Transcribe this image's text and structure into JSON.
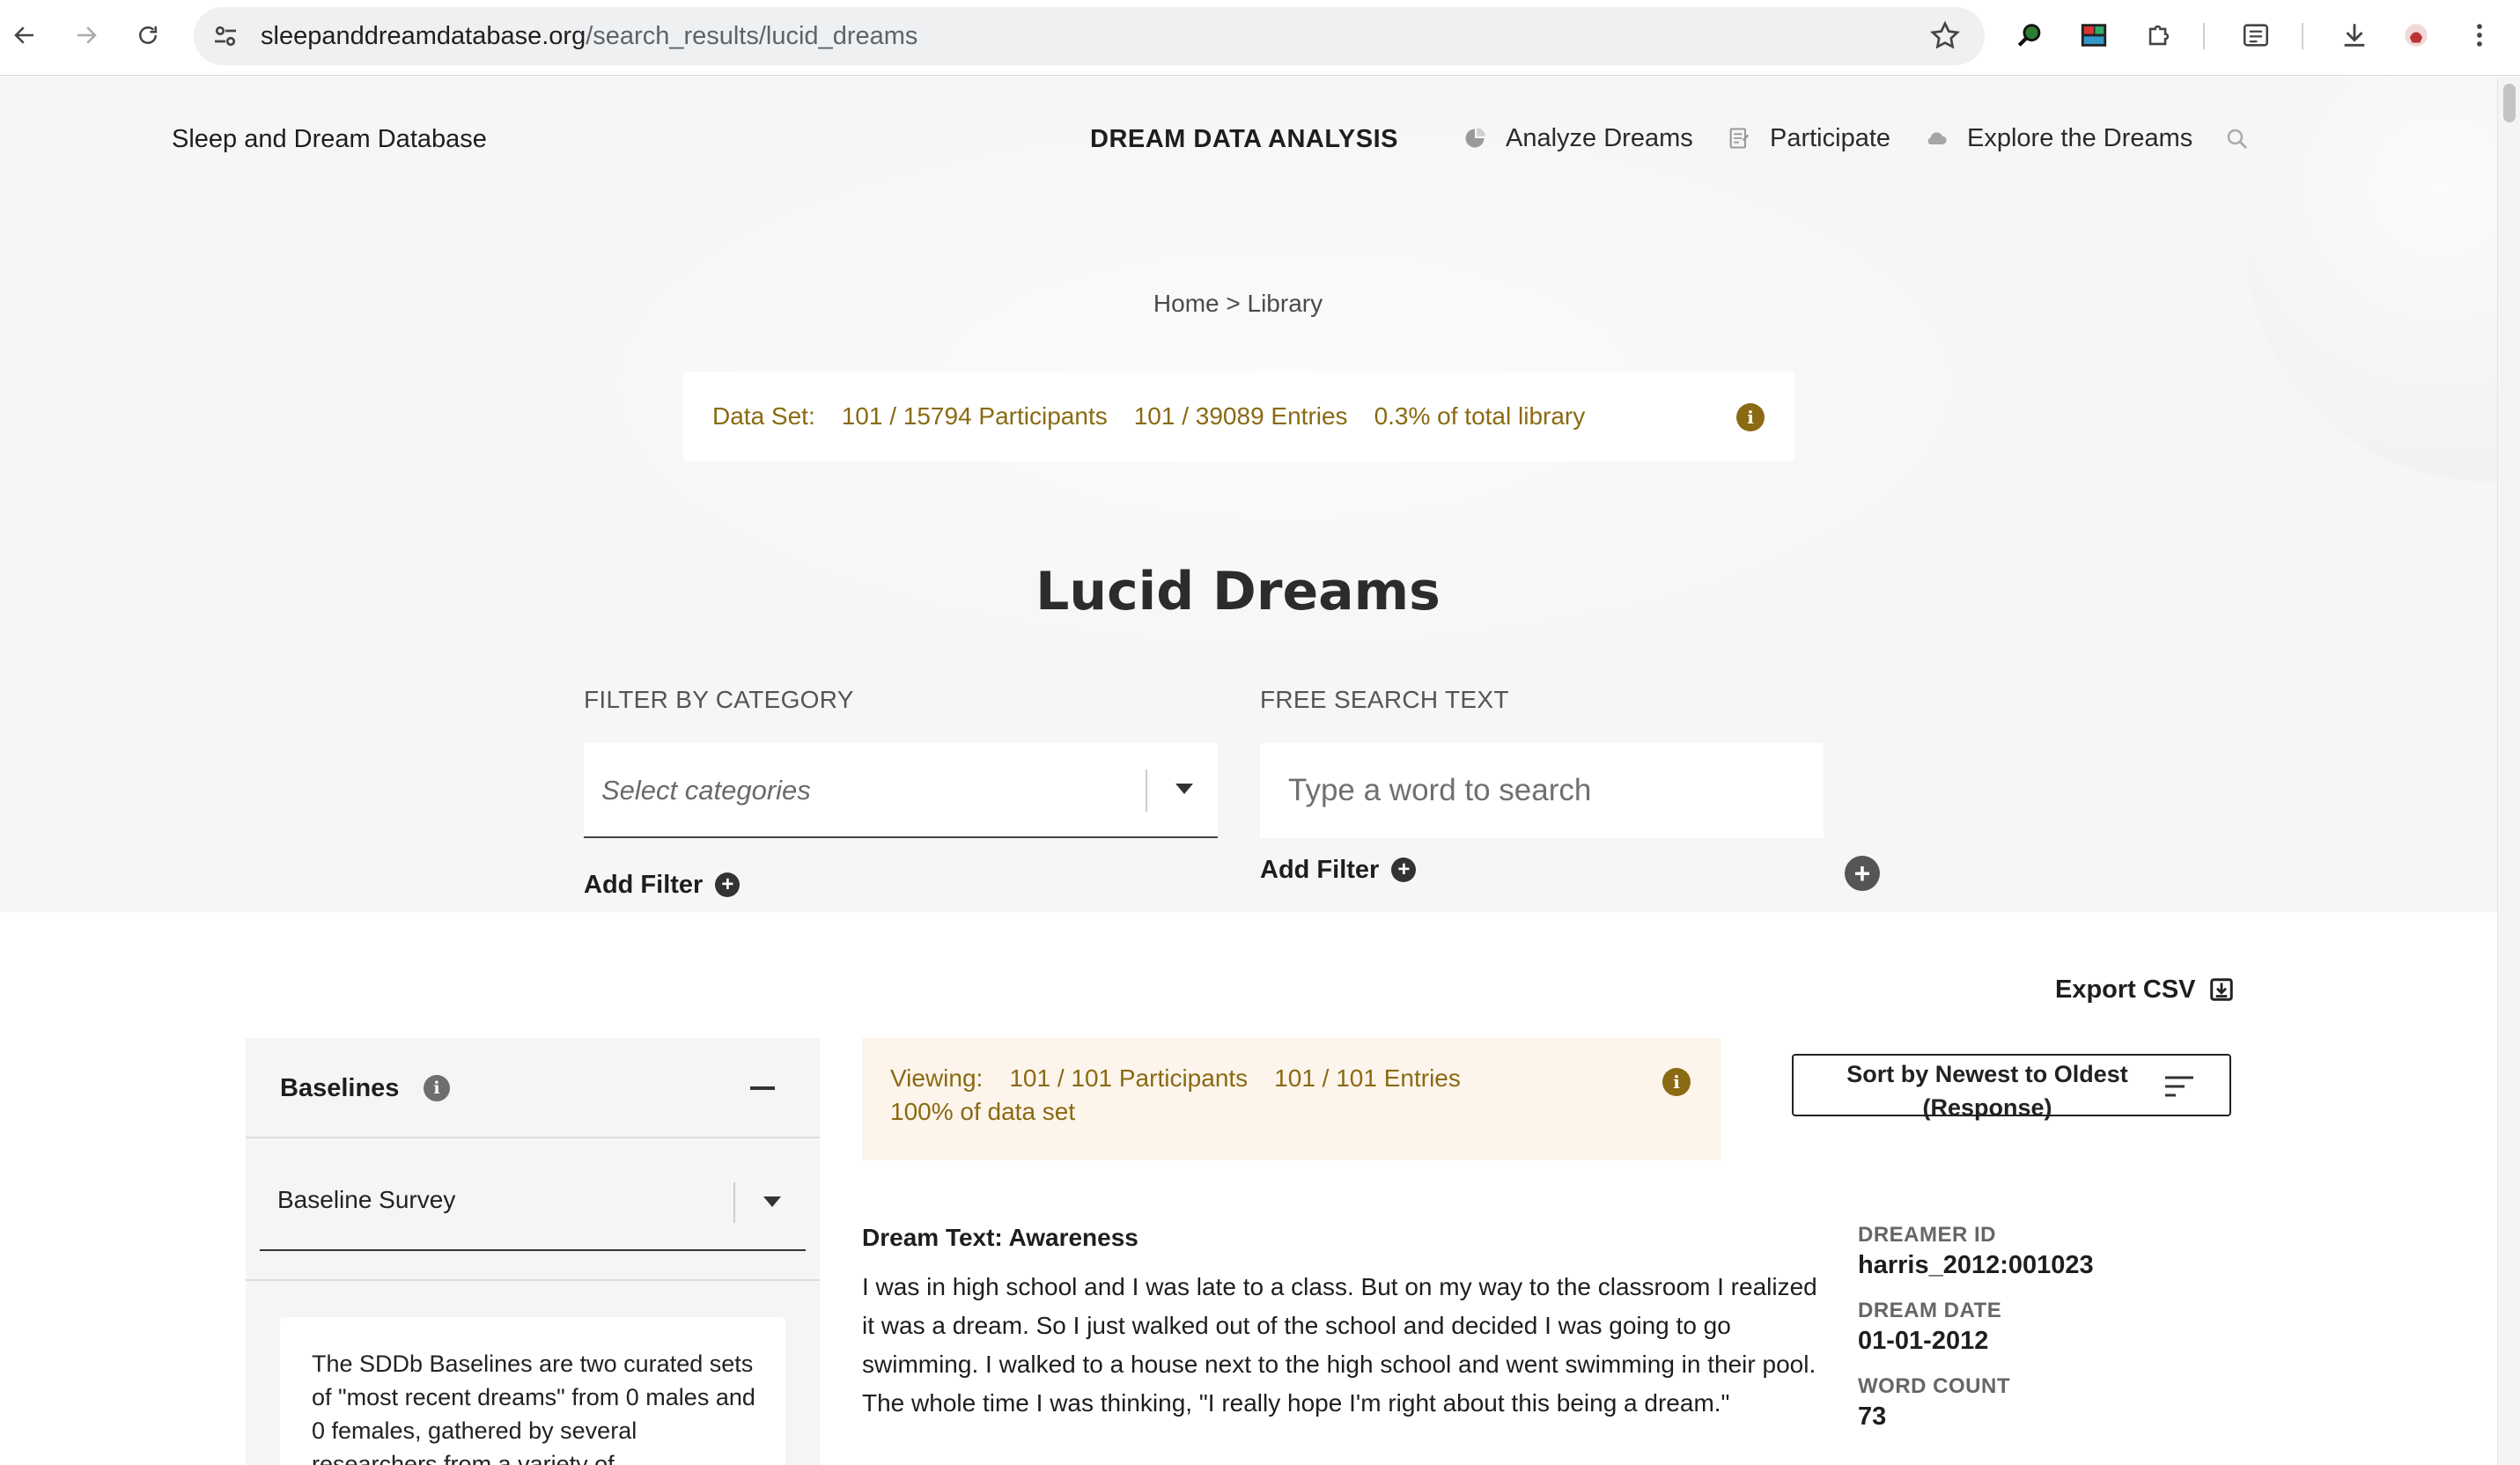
{
  "browser": {
    "url_domain": "sleepanddreamdatabase.org",
    "url_path": "/search_results/lucid_dreams"
  },
  "header": {
    "site_title": "Sleep and Dream Database",
    "section_title": "DREAM DATA ANALYSIS",
    "nav": [
      {
        "label": "Analyze Dreams",
        "icon": "pie-chart-icon"
      },
      {
        "label": "Participate",
        "icon": "form-icon"
      },
      {
        "label": "Explore the Dreams",
        "icon": "cloud-icon"
      }
    ]
  },
  "breadcrumb": "Home > Library",
  "dataset": {
    "label": "Data Set:",
    "participants": "101 / 15794 Participants",
    "entries": "101 / 39089 Entries",
    "percent": "0.3% of total library"
  },
  "page_heading": "Lucid Dreams",
  "filters": {
    "category_label": "FILTER BY CATEGORY",
    "category_placeholder": "Select categories",
    "search_label": "FREE SEARCH TEXT",
    "search_placeholder": "Type a word to search",
    "add_filter_label": "Add Filter"
  },
  "results": {
    "export_label": "Export CSV",
    "viewing_label": "Viewing:",
    "viewing_participants": "101 / 101 Participants",
    "viewing_entries": "101 / 101 Entries",
    "viewing_percent": "100% of data set",
    "sort_label": "Sort by Newest to Oldest (Response)"
  },
  "sidebar": {
    "title": "Baselines",
    "select_value": "Baseline Survey",
    "description": "The SDDb Baselines are two curated sets of \"most recent dreams\" from 0 males and 0 females, gathered by several researchers from a variety of"
  },
  "dream": {
    "title": "Dream Text: Awareness",
    "text": "I was in high school and I was late to a class. But on my way to the classroom I realized it was a dream. So I just walked out of the school and decided I was going to go swimming. I walked to a house next to the high school and went swimming in their pool. The whole time I was thinking, \"I really hope I'm right about this being a dream.\"",
    "dreamer_id_label": "DREAMER ID",
    "dreamer_id": "harris_2012:001023",
    "date_label": "DREAM DATE",
    "date": "01-01-2012",
    "word_count_label": "WORD COUNT",
    "word_count": "73"
  },
  "colors": {
    "gold_text": "#8a6a12",
    "viewing_bg": "#fdf5ec",
    "page_gray": "#f6f6f6"
  }
}
